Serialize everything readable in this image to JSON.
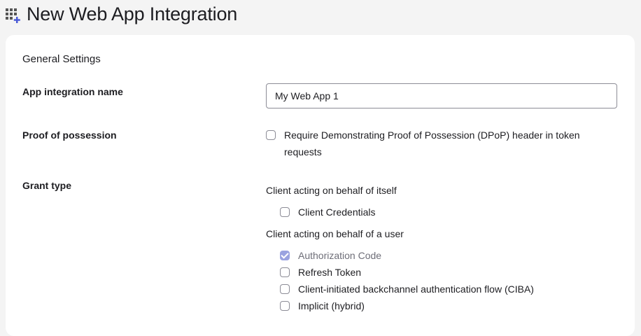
{
  "header": {
    "title": "New Web App Integration",
    "icon": "app-grid-add-icon"
  },
  "card": {
    "section_title": "General Settings",
    "app_name": {
      "label": "App integration name",
      "value": "My Web App 1"
    },
    "proof": {
      "label": "Proof of possession",
      "option_line1": "Require Demonstrating Proof of Possession (DPoP) header in token",
      "option_line2": "requests",
      "checked": false
    },
    "grant": {
      "label": "Grant type",
      "group1_label": "Client acting on behalf of itself",
      "group1_options": [
        {
          "label": "Client Credentials",
          "checked": false
        }
      ],
      "group2_label": "Client acting on behalf of a user",
      "group2_options": [
        {
          "label": "Authorization Code",
          "checked": true,
          "disabled": true
        },
        {
          "label": "Refresh Token",
          "checked": false
        },
        {
          "label": "Client-initiated backchannel authentication flow (CIBA)",
          "checked": false
        },
        {
          "label": "Implicit (hybrid)",
          "checked": false
        }
      ]
    }
  },
  "colors": {
    "accent": "#9aa3e0",
    "icon_blue": "#4a5ad6"
  }
}
